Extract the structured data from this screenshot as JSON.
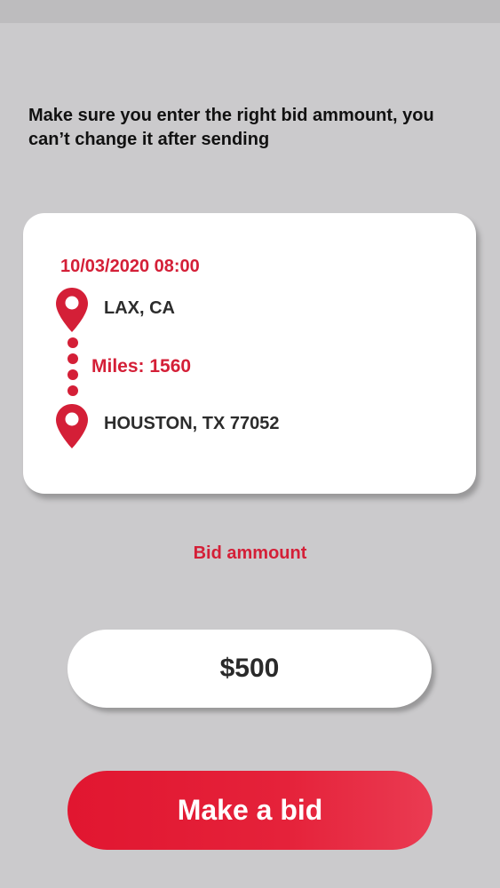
{
  "warning_text": "Make sure you enter the right bid ammount, you can’t change it after sending",
  "trip": {
    "date_time": "10/03/2020 08:00",
    "origin": "LAX, CA",
    "miles": "Miles: 1560",
    "destination": "HOUSTON, TX 77052"
  },
  "bid": {
    "label": "Bid ammount",
    "value": "$500"
  },
  "submit_button": {
    "label": "Make a bid"
  },
  "icons": {
    "origin": "map-pin-icon",
    "destination": "map-pin-icon",
    "route": "route-dots-icon"
  },
  "colors": {
    "accent": "#d41f37",
    "background": "#cbcacc",
    "card": "#ffffff",
    "text": "#2c2c2c"
  }
}
